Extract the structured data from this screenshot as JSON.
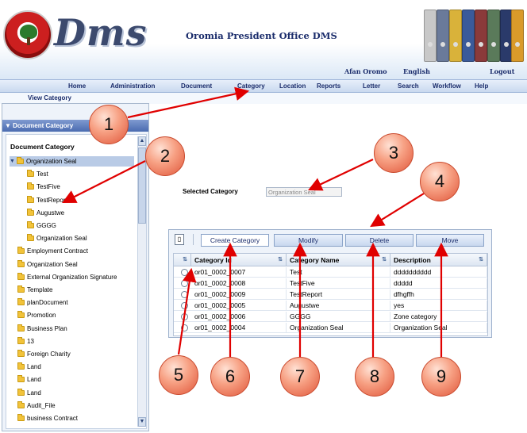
{
  "header": {
    "logo_text": "Dms",
    "app_title": "Oromia President Office DMS",
    "lang_links": [
      "Afan Oromo",
      "English"
    ],
    "logout_label": "Logout"
  },
  "nav": {
    "items": [
      "Home",
      "Administration",
      "Document",
      "Category",
      "Location",
      "Reports",
      "Letter",
      "Search",
      "Workflow",
      "Help"
    ],
    "sub_item": "View Category"
  },
  "sidebar": {
    "header": "Document Category",
    "tree_title": "Document Category",
    "tree": [
      {
        "label": "Organization Seal",
        "level": 0,
        "expanded": true,
        "selected": true
      },
      {
        "label": "Test",
        "level": 1
      },
      {
        "label": "TestFive",
        "level": 1
      },
      {
        "label": "TestReport",
        "level": 1
      },
      {
        "label": "Augustwe",
        "level": 1
      },
      {
        "label": "GGGG",
        "level": 1
      },
      {
        "label": "Organization Seal",
        "level": 1
      },
      {
        "label": "Employment Contract",
        "level": 0
      },
      {
        "label": "Organization Seal",
        "level": 0
      },
      {
        "label": "External Organization Signature",
        "level": 0
      },
      {
        "label": "Template",
        "level": 0
      },
      {
        "label": "planDocument",
        "level": 0
      },
      {
        "label": "Promotion",
        "level": 0
      },
      {
        "label": "Business Plan",
        "level": 0
      },
      {
        "label": "13",
        "level": 0
      },
      {
        "label": "Foreign Charity",
        "level": 0
      },
      {
        "label": "Land",
        "level": 0
      },
      {
        "label": "Land",
        "level": 0
      },
      {
        "label": "Land",
        "level": 0
      },
      {
        "label": "Audit_File",
        "level": 0
      },
      {
        "label": "business Contract",
        "level": 0
      }
    ]
  },
  "main": {
    "selected_category_label": "Selected Category",
    "selected_category_value": "Organization Seal",
    "toolbar": {
      "create_label": "Create Category",
      "modify_label": "Modify",
      "delete_label": "Delete",
      "move_label": "Move"
    },
    "grid": {
      "columns": [
        "Category Id",
        "Category Name",
        "Description"
      ],
      "rows": [
        [
          "or01_0002_0007",
          "Test",
          "dddddddddd"
        ],
        [
          "or01_0002_0008",
          "TestFive",
          "ddddd"
        ],
        [
          "or01_0002_0009",
          "TestReport",
          "dfhgffh"
        ],
        [
          "or01_0002_0005",
          "Augustwe",
          "yes"
        ],
        [
          "or01_0002_0006",
          "GGGG",
          "Zone category"
        ],
        [
          "or01_0002_0004",
          "Organization Seal",
          "Organization Seal"
        ]
      ]
    }
  },
  "callouts": [
    "1",
    "2",
    "3",
    "4",
    "5",
    "6",
    "7",
    "8",
    "9"
  ],
  "colors": {
    "nav_text": "#1a2c6b",
    "callout_fill": "#f7a184",
    "arrow": "#e00000",
    "sidebar_header": "#4a6bb0"
  }
}
